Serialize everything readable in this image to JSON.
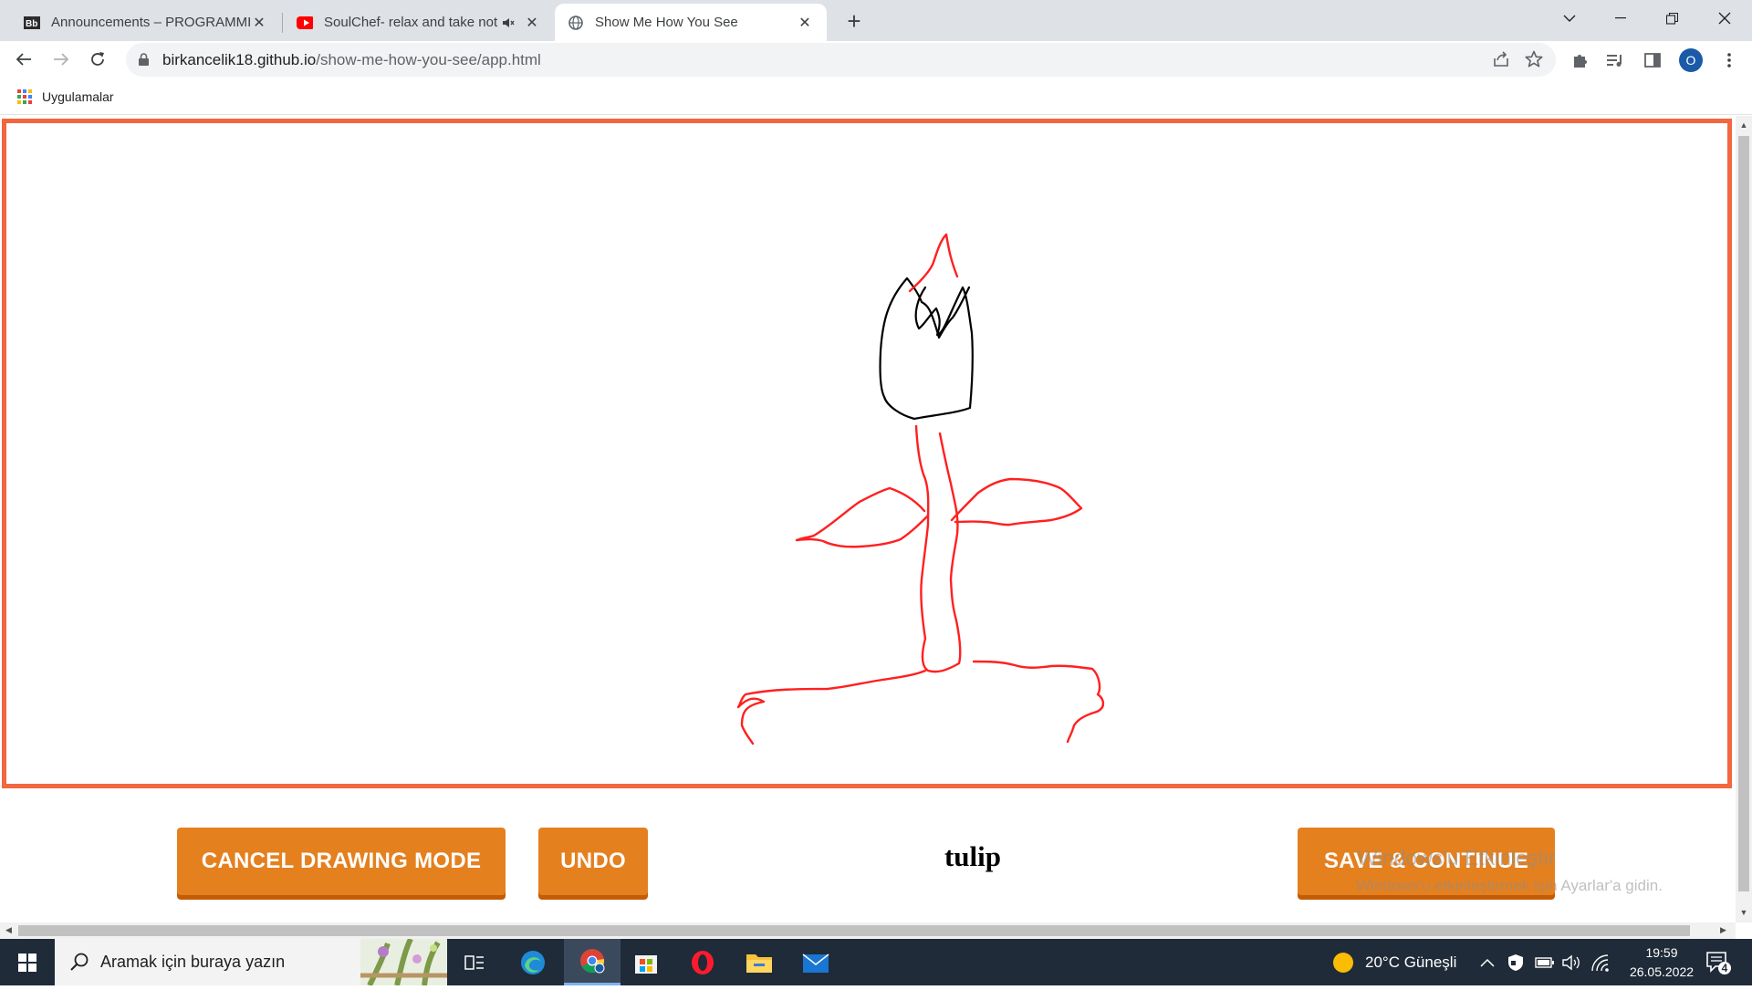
{
  "browser": {
    "tabs": [
      {
        "title": "Announcements – PROGRAMMIN",
        "favicon": "bb-icon",
        "active": false
      },
      {
        "title": "SoulChef- relax and take not",
        "favicon": "youtube-icon",
        "active": false,
        "muted_audio": true
      },
      {
        "title": "Show Me How You See",
        "favicon": "globe-icon",
        "active": true
      }
    ],
    "url_domain": "birkancelik18.github.io",
    "url_path": "/show-me-how-you-see/app.html",
    "profile_initial": "O",
    "bookmarks": [
      {
        "label": "Uygulamalar",
        "icon": "apps-grid-icon"
      }
    ]
  },
  "app": {
    "canvas_border_color": "#f26640",
    "stroke_colors": {
      "flower_head": "#000000",
      "stem_and_leaves": "#ff2020"
    },
    "buttons": {
      "cancel": "CANCEL DRAWING MODE",
      "undo": "UNDO",
      "save": "SAVE & CONTINUE"
    },
    "button_color": "#e5801f",
    "word": "tulip"
  },
  "watermark": {
    "line1": "Windows'u Etkinleştir",
    "line2": "Windows'u etkinleştirmek için Ayarlar'a gidin."
  },
  "taskbar": {
    "search_placeholder": "Aramak için buraya yazın",
    "weather": "20°C  Güneşli",
    "time": "19:59",
    "date": "26.05.2022",
    "notification_count": "4"
  }
}
